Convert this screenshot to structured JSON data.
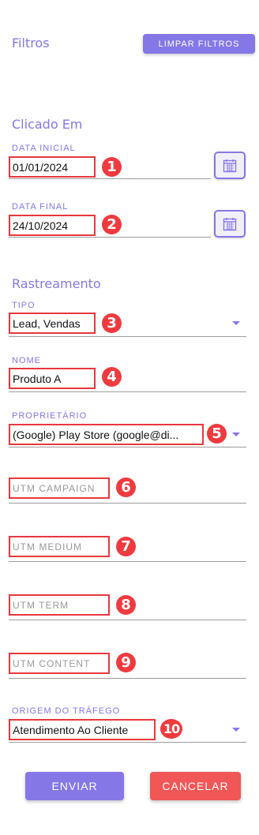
{
  "header": {
    "title": "Filtros",
    "clear_label": "LIMPAR FILTROS"
  },
  "sections": {
    "clicked": "Clicado Em",
    "tracking": "Rastreamento"
  },
  "fields": {
    "start_date": {
      "label": "DATA INICIAL",
      "value": "01/01/2024",
      "badge": "1"
    },
    "end_date": {
      "label": "DATA FINAL",
      "value": "24/10/2024",
      "badge": "2"
    },
    "type": {
      "label": "TIPO",
      "value": "Lead, Vendas",
      "badge": "3"
    },
    "name": {
      "label": "NOME",
      "value": "Produto A",
      "badge": "4"
    },
    "owner": {
      "label": "PROPRIETÁRIO",
      "value": "(Google) Play Store (google@di...",
      "badge": "5"
    },
    "utm_campaign": {
      "placeholder": "UTM CAMPAIGN",
      "badge": "6"
    },
    "utm_medium": {
      "placeholder": "UTM MEDIUM",
      "badge": "7"
    },
    "utm_term": {
      "placeholder": "UTM TERM",
      "badge": "8"
    },
    "utm_content": {
      "placeholder": "UTM CONTENT",
      "badge": "9"
    },
    "traffic_origin": {
      "label": "ORIGEM DO TRÁFEGO",
      "value": "Atendimento Ao Cliente",
      "badge": "10"
    }
  },
  "actions": {
    "submit_label": "ENVIAR",
    "cancel_label": "CANCELAR"
  },
  "colors": {
    "accent": "#8577e6",
    "highlight": "#e8383d",
    "cancel": "#f15757"
  },
  "icons": {
    "calendar": "calendar-icon",
    "dropdown": "chevron-down-icon"
  }
}
